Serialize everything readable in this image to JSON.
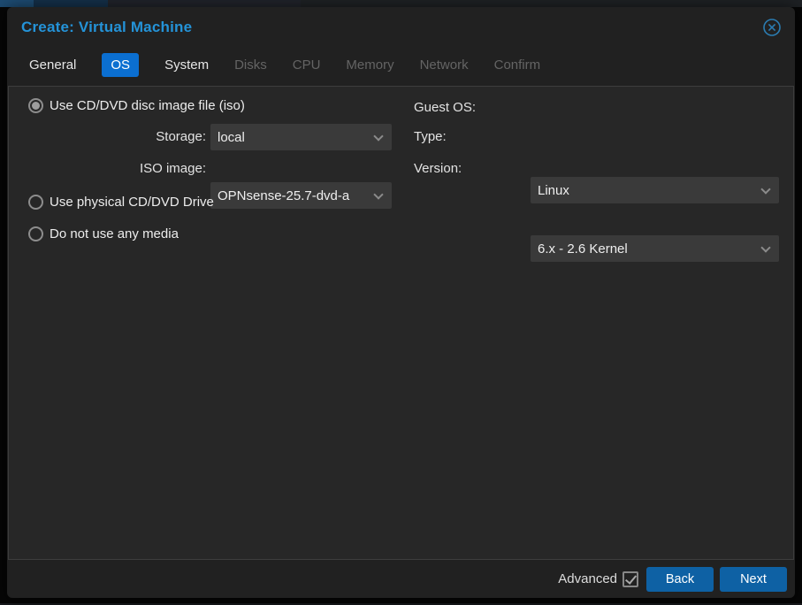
{
  "window": {
    "title": "Create: Virtual Machine"
  },
  "tabs": [
    {
      "label": "General",
      "state": "enabled"
    },
    {
      "label": "OS",
      "state": "active"
    },
    {
      "label": "System",
      "state": "enabled"
    },
    {
      "label": "Disks",
      "state": "disabled"
    },
    {
      "label": "CPU",
      "state": "disabled"
    },
    {
      "label": "Memory",
      "state": "disabled"
    },
    {
      "label": "Network",
      "state": "disabled"
    },
    {
      "label": "Confirm",
      "state": "disabled"
    }
  ],
  "form": {
    "radios": [
      {
        "label": "Use CD/DVD disc image file (iso)",
        "selected": true
      },
      {
        "label": "Use physical CD/DVD Drive",
        "selected": false
      },
      {
        "label": "Do not use any media",
        "selected": false
      }
    ],
    "left_fields": [
      {
        "label": "Storage:",
        "value": "local"
      },
      {
        "label": "ISO image:",
        "value": "OPNsense-25.7-dvd-a"
      }
    ],
    "guest_os": {
      "heading": "Guest OS:",
      "fields": [
        {
          "label": "Type:",
          "value": "Linux"
        },
        {
          "label": "Version:",
          "value": "6.x - 2.6 Kernel"
        }
      ]
    }
  },
  "footer": {
    "advanced_label": "Advanced",
    "advanced_checked": true,
    "back_label": "Back",
    "next_label": "Next"
  },
  "colors": {
    "title_blue": "#2493d8",
    "active_tab_blue": "#0b6fd1",
    "button_blue": "#0e61a4",
    "panel_bg": "#272727",
    "dialog_bg": "#212121",
    "field_bg": "#3a3a3a"
  }
}
